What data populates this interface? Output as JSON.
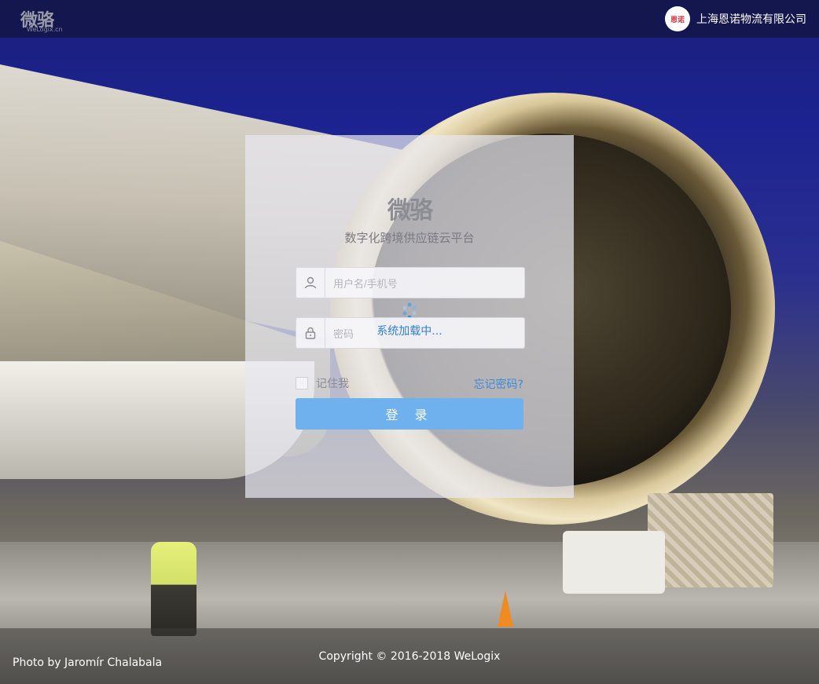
{
  "header": {
    "logo_cn": "微骆",
    "logo_en": "WeLogix.cn",
    "company_logo_text": "恩诺",
    "company_name": "上海恩诺物流有限公司"
  },
  "login": {
    "brand_logo": "微骆",
    "tagline": "数字化跨境供应链云平台",
    "username_placeholder": "用户名/手机号",
    "password_placeholder": "密码",
    "loading_text": "系统加载中...",
    "remember_label": "记住我",
    "forgot_label": "忘记密码?",
    "submit_label": "登 录"
  },
  "footer": {
    "photo_credit": "Photo by Jaromír Chalabala",
    "copyright": "Copyright © 2016-2018 WeLogix"
  },
  "colors": {
    "accent": "#6fb0ef",
    "link": "#3b8ad8",
    "topbar": "#141646"
  },
  "icons": {
    "user": "user-icon",
    "lock": "lock-icon",
    "spinner": "loading-spinner-icon"
  }
}
